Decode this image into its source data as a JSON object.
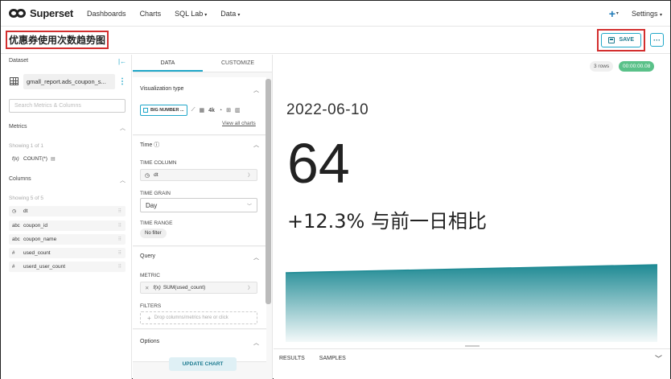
{
  "nav": {
    "logo_text": "Superset",
    "items": [
      "Dashboards",
      "Charts",
      "SQL Lab",
      "Data"
    ],
    "plus": "+",
    "settings": "Settings"
  },
  "header": {
    "title": "优惠券使用次数趋势图",
    "save_label": "SAVE",
    "more_label": "···"
  },
  "dataset": {
    "section_label": "Dataset",
    "name": "gmall_report.ads_coupon_s...",
    "search_placeholder": "Search Metrics & Columns",
    "metrics_label": "Metrics",
    "metrics_showing": "Showing 1 of 1",
    "metrics": [
      {
        "type": "f(x)",
        "name": "COUNT(*)"
      }
    ],
    "columns_label": "Columns",
    "columns_showing": "Showing 5 of 5",
    "columns": [
      {
        "type": "◷",
        "name": "dt"
      },
      {
        "type": "abc",
        "name": "coupon_id"
      },
      {
        "type": "abc",
        "name": "coupon_name"
      },
      {
        "type": "#",
        "name": "used_count"
      },
      {
        "type": "#",
        "name": "userd_user_count"
      }
    ]
  },
  "control": {
    "tab_data": "DATA",
    "tab_customize": "CUSTOMIZE",
    "viz_type_title": "Visualization type",
    "viz_chip": "BIG NUMBER ...",
    "viz_icons": [
      "⟋",
      "▦",
      "4k",
      "◔",
      "⊞",
      "▥"
    ],
    "view_all": "View all charts",
    "time_title": "Time ⓘ",
    "time_column_label": "TIME COLUMN",
    "time_column_value": "dt",
    "time_grain_label": "TIME GRAIN",
    "time_grain_value": "Day",
    "time_range_label": "TIME RANGE",
    "time_range_value": "No filter",
    "query_title": "Query",
    "metric_label": "METRIC",
    "metric_value": "SUM(used_count)",
    "filters_label": "FILTERS",
    "filters_placeholder": "Drop columns/metrics here or click",
    "options_title": "Options",
    "update_label": "UPDATE CHART"
  },
  "chart": {
    "rows_badge": "3 rows",
    "time_badge": "00:00:00.08",
    "date": "2022-06-10",
    "big_number": "64",
    "subheader": "+12.3% 与前一日相比",
    "trendline_color": "#1f8a94",
    "results_tab": "RESULTS",
    "samples_tab": "SAMPLES"
  }
}
